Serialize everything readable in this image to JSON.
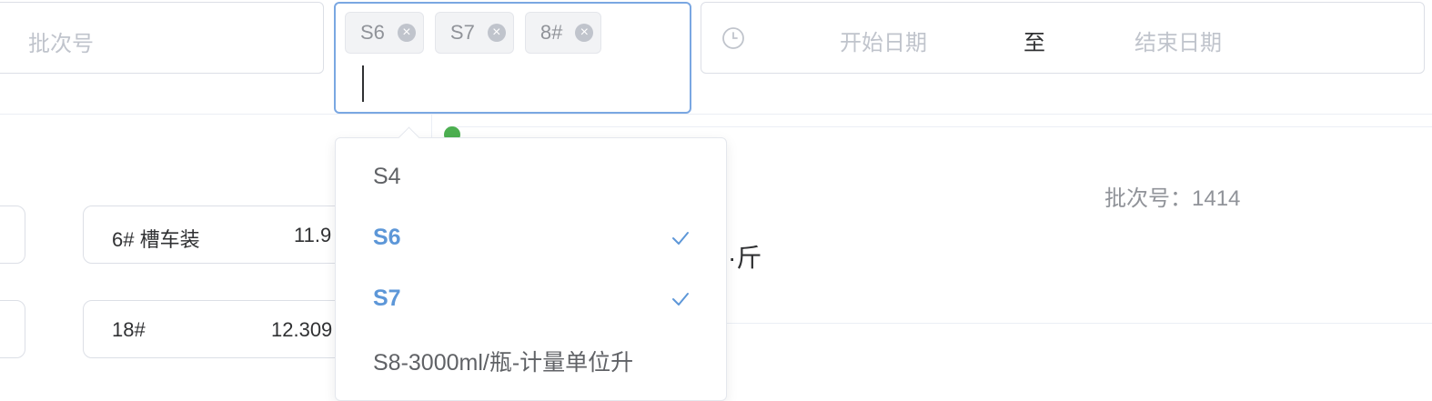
{
  "filters": {
    "batch_placeholder": "批次号",
    "selected_tags": [
      "S6",
      "S7",
      "8#"
    ],
    "date_start_placeholder": "开始日期",
    "date_separator": "至",
    "date_end_placeholder": "结束日期",
    "clock_icon": "clock-icon",
    "tag_close_icon": "close-circle-icon"
  },
  "dropdown": {
    "options": [
      {
        "label": "S4",
        "selected": false
      },
      {
        "label": "S6",
        "selected": true
      },
      {
        "label": "S7",
        "selected": true
      },
      {
        "label": "S8-3000ml/瓶-计量单位升",
        "selected": false
      }
    ],
    "check_icon": "check-icon",
    "selected_color": "#5d97d8"
  },
  "content": {
    "batch_info": "批次号：1414",
    "unit_text": "·斤",
    "cards": [
      {
        "name": "6# 槽车装",
        "value": "11.9"
      },
      {
        "name": "18#",
        "value": "12.309"
      }
    ]
  },
  "colors": {
    "focus_border": "#7aa7e2",
    "placeholder": "#c0c4cc",
    "status_green": "#4caf50"
  }
}
